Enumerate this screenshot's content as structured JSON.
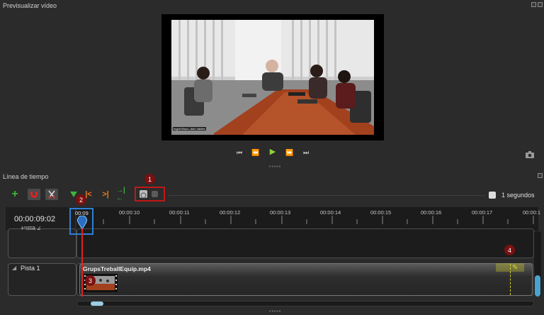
{
  "preview": {
    "title": "Previsualizar vídeo",
    "video_caption": "Ingrid Bravo, Aldo Valdés",
    "controls": {
      "start": "⏮",
      "rewind": "⏪",
      "play": "▶",
      "forward": "⏩",
      "end": "⏭"
    }
  },
  "timeline": {
    "title": "Línea de tiempo",
    "zoom_label": "1 segundos",
    "current_time": "00:00:09:02",
    "ruler_labels": [
      "00:09",
      "00:00:10",
      "00:00:11",
      "00:00:12",
      "00:00:13",
      "00:00:14",
      "00:00:15",
      "00:00:16",
      "00:00:17",
      "00:00:1"
    ],
    "tracks": [
      {
        "name": "Pista 2"
      },
      {
        "name": "Pista 1",
        "clip": "GrupsTreballEquip.mp4"
      }
    ],
    "markers": [
      "1",
      "2",
      "3",
      "4"
    ]
  },
  "colors": {
    "accent_red": "#c01818",
    "green": "#3db33d",
    "selection_blue": "#2d7fd8",
    "playhead": "#e02020",
    "yellow": "#d8d82a"
  }
}
